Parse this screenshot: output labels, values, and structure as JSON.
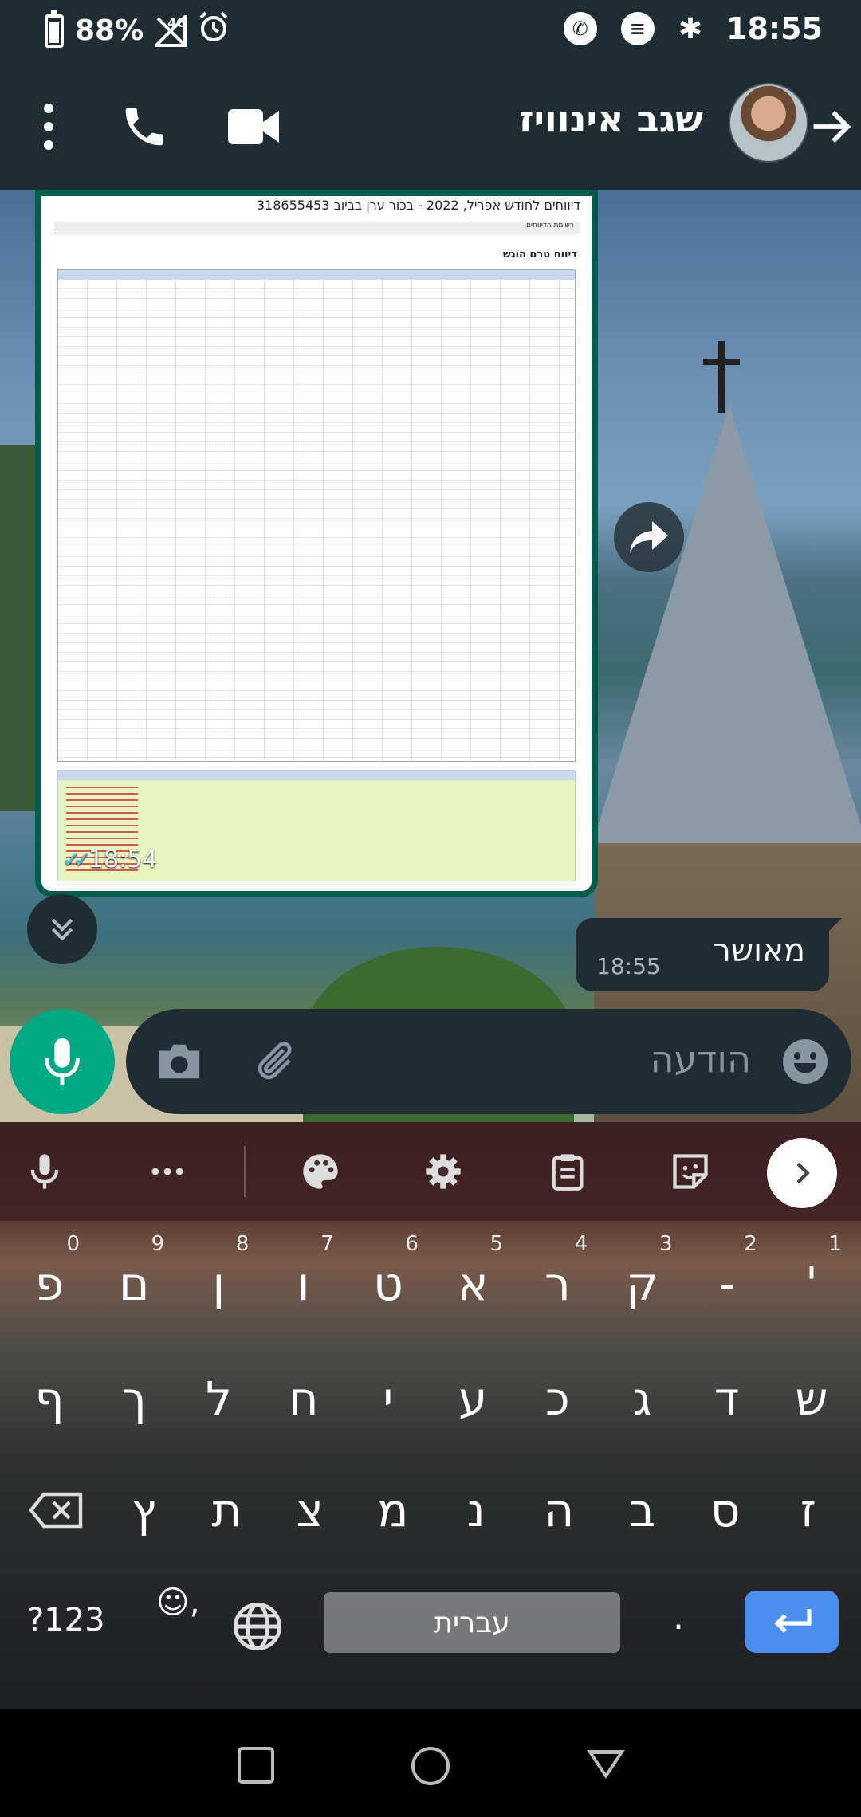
{
  "status_bar": {
    "battery": "88%",
    "network": "4G",
    "time": "18:55"
  },
  "header": {
    "contact_name": "שגב אינוויז"
  },
  "image_message": {
    "doc_title": "דיווחים לחודש אפריל, 2022 - בכור ערן בביוב 318655453",
    "doc_tab": "רשימת הדיווחים",
    "doc_subtitle": "דיווח טרם הוגש",
    "time": "18:54"
  },
  "text_message": {
    "text": "מאושר",
    "time": "18:55"
  },
  "composer": {
    "placeholder": "הודעה"
  },
  "keyboard": {
    "row1": [
      {
        "key": "פ",
        "hint": "0"
      },
      {
        "key": "ם",
        "hint": "9"
      },
      {
        "key": "ן",
        "hint": "8"
      },
      {
        "key": "ו",
        "hint": "7"
      },
      {
        "key": "ט",
        "hint": "6"
      },
      {
        "key": "א",
        "hint": "5"
      },
      {
        "key": "ר",
        "hint": "4"
      },
      {
        "key": "ק",
        "hint": "3"
      },
      {
        "key": "-",
        "hint": "2"
      },
      {
        "key": "'",
        "hint": "1"
      }
    ],
    "row2": [
      "ף",
      "ך",
      "ל",
      "ח",
      "י",
      "ע",
      "כ",
      "ג",
      "ד",
      "ש"
    ],
    "row3": [
      "ץ",
      "ת",
      "צ",
      "מ",
      "נ",
      "ה",
      "ב",
      "ס",
      "ז"
    ],
    "sym_label": "?123",
    "emoji_label": "☺,",
    "space_label": "עברית",
    "period_label": "."
  }
}
